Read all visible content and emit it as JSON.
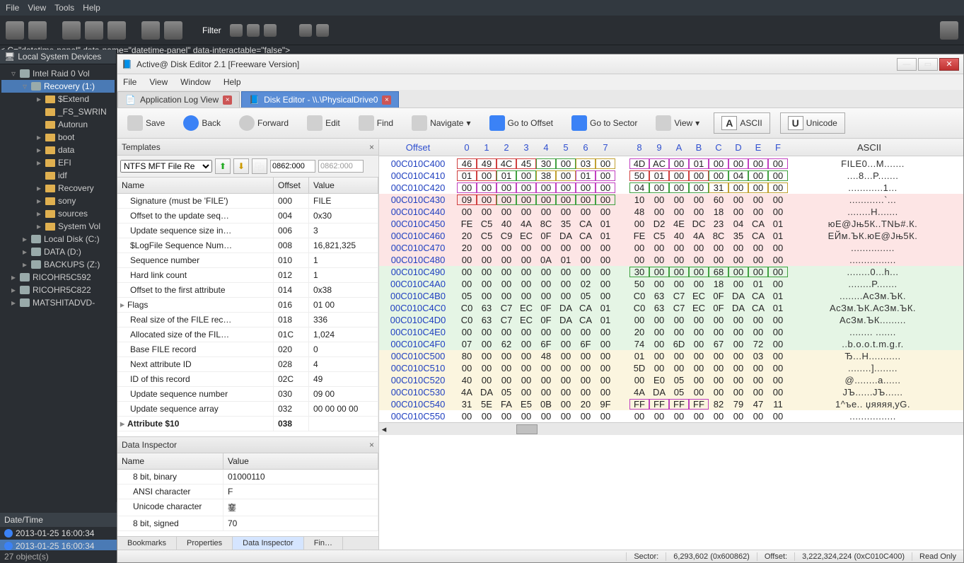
{
  "dark_app": {
    "menubar": [
      "File",
      "View",
      "Tools",
      "Help"
    ],
    "filter_label": "Filter",
    "devices_header": "Local System Devices",
    "tree": [
      {
        "lvl": 1,
        "exp": "▿",
        "icon": "drive",
        "label": "Intel   Raid 0 Vol"
      },
      {
        "lvl": 2,
        "exp": "▿",
        "icon": "drive",
        "label": "Recovery (1:)",
        "sel": true
      },
      {
        "lvl": 3,
        "exp": "▸",
        "icon": "folder",
        "label": "$Extend"
      },
      {
        "lvl": 3,
        "exp": "",
        "icon": "folder",
        "label": "_FS_SWRIN"
      },
      {
        "lvl": 3,
        "exp": "",
        "icon": "folder",
        "label": "Autorun"
      },
      {
        "lvl": 3,
        "exp": "▸",
        "icon": "folder",
        "label": "boot"
      },
      {
        "lvl": 3,
        "exp": "▸",
        "icon": "folder",
        "label": "data"
      },
      {
        "lvl": 3,
        "exp": "▸",
        "icon": "folder",
        "label": "EFI"
      },
      {
        "lvl": 3,
        "exp": "",
        "icon": "folder",
        "label": "idf"
      },
      {
        "lvl": 3,
        "exp": "▸",
        "icon": "folder",
        "label": "Recovery"
      },
      {
        "lvl": 3,
        "exp": "▸",
        "icon": "folder",
        "label": "sony"
      },
      {
        "lvl": 3,
        "exp": "▸",
        "icon": "folder",
        "label": "sources"
      },
      {
        "lvl": 3,
        "exp": "▸",
        "icon": "folder",
        "label": "System Vol"
      },
      {
        "lvl": 2,
        "exp": "▸",
        "icon": "drive",
        "label": "Local Disk (C:)"
      },
      {
        "lvl": 2,
        "exp": "▸",
        "icon": "drive",
        "label": "DATA (D:)"
      },
      {
        "lvl": 2,
        "exp": "▸",
        "icon": "drive",
        "label": "BACKUPS (Z:)"
      },
      {
        "lvl": 1,
        "exp": "▸",
        "icon": "drive",
        "label": "RICOHR5C592"
      },
      {
        "lvl": 1,
        "exp": "▸",
        "icon": "drive",
        "label": "RICOHR5C822"
      },
      {
        "lvl": 1,
        "exp": "▸",
        "icon": "drive",
        "label": "MATSHITADVD-"
      }
    ],
    "datetime_header": "Date/Time",
    "datetimes": [
      "2013-01-25 16:00:34",
      "2013-01-25 16:00:34"
    ],
    "status": "27 object(s)"
  },
  "editor": {
    "title": "Active@ Disk Editor 2.1 [Freeware Version]",
    "menubar": [
      "File",
      "View",
      "Window",
      "Help"
    ],
    "tabs": [
      {
        "label": "Application Log View",
        "active": false
      },
      {
        "label": "Disk Editor - \\\\.\\PhysicalDrive0",
        "active": true
      }
    ],
    "toolbar": {
      "save": "Save",
      "back": "Back",
      "forward": "Forward",
      "edit": "Edit",
      "find": "Find",
      "navigate": "Navigate",
      "goto_offset": "Go to Offset",
      "goto_sector": "Go to Sector",
      "view": "View",
      "ascii": "ASCII",
      "unicode": "Unicode"
    },
    "templates": {
      "title": "Templates",
      "dropdown": "NTFS MFT File Re",
      "offset_a": "0862:000",
      "offset_b": "0862:000",
      "cols": {
        "name": "Name",
        "offset": "Offset",
        "value": "Value"
      },
      "rows": [
        {
          "name": "Signature (must be 'FILE')",
          "offset": "000",
          "value": "FILE"
        },
        {
          "name": "Offset to the update seq…",
          "offset": "004",
          "value": "0x30"
        },
        {
          "name": "Update sequence size in…",
          "offset": "006",
          "value": "3"
        },
        {
          "name": "$LogFile Sequence Num…",
          "offset": "008",
          "value": "16,821,325"
        },
        {
          "name": "Sequence number",
          "offset": "010",
          "value": "1"
        },
        {
          "name": "Hard link count",
          "offset": "012",
          "value": "1"
        },
        {
          "name": "Offset to the first attribute",
          "offset": "014",
          "value": "0x38"
        },
        {
          "name": "Flags",
          "offset": "016",
          "value": "01 00",
          "expandable": true
        },
        {
          "name": "Real size of the FILE rec…",
          "offset": "018",
          "value": "336"
        },
        {
          "name": "Allocated size of the FIL…",
          "offset": "01C",
          "value": "1,024"
        },
        {
          "name": "Base FILE record",
          "offset": "020",
          "value": "0"
        },
        {
          "name": "Next attribute ID",
          "offset": "028",
          "value": "4"
        },
        {
          "name": "ID of this record",
          "offset": "02C",
          "value": "49"
        },
        {
          "name": "Update sequence number",
          "offset": "030",
          "value": "09 00"
        },
        {
          "name": "Update sequence array",
          "offset": "032",
          "value": "00 00 00 00"
        },
        {
          "name": "Attribute $10",
          "offset": "038",
          "value": "",
          "bold": true,
          "expandable": true
        }
      ]
    },
    "inspector": {
      "title": "Data Inspector",
      "cols": {
        "name": "Name",
        "value": "Value"
      },
      "rows": [
        {
          "name": "8 bit, binary",
          "value": "01000110"
        },
        {
          "name": "ANSI character",
          "value": "F"
        },
        {
          "name": "Unicode character",
          "value": "䥆"
        },
        {
          "name": "8 bit, signed",
          "value": "70"
        }
      ],
      "bottom_tabs": [
        "Bookmarks",
        "Properties",
        "Data Inspector",
        "Fin…"
      ]
    },
    "hex": {
      "header_offset": "Offset",
      "header_ascii": "ASCII",
      "nybbles": [
        "0",
        "1",
        "2",
        "3",
        "4",
        "5",
        "6",
        "7",
        "-",
        "8",
        "9",
        "A",
        "B",
        "C",
        "D",
        "E",
        "F"
      ],
      "rows": [
        {
          "off": "00C010C400",
          "l": [
            "46",
            "49",
            "4C",
            "45",
            "30",
            "00",
            "03",
            "00"
          ],
          "r": [
            "4D",
            "AC",
            "00",
            "01",
            "00",
            "00",
            "00",
            "00"
          ],
          "asc": "FILE0...M.......",
          "hl": {
            "l": [
              [
                "hl-red",
                0,
                3
              ],
              [
                "hl-grn",
                4,
                5
              ],
              [
                "hl-yel",
                6,
                7
              ]
            ],
            "r": [
              [
                "hl-mag",
                0,
                7
              ]
            ]
          }
        },
        {
          "off": "00C010C410",
          "l": [
            "01",
            "00",
            "01",
            "00",
            "38",
            "00",
            "01",
            "00"
          ],
          "r": [
            "50",
            "01",
            "00",
            "00",
            "00",
            "04",
            "00",
            "00"
          ],
          "asc": "....8...P.......",
          "hl": {
            "l": [
              [
                "hl-red",
                0,
                1
              ],
              [
                "hl-grn",
                2,
                3
              ],
              [
                "hl-yel",
                4,
                5
              ],
              [
                "hl-mag",
                6,
                7
              ]
            ],
            "r": [
              [
                "hl-red",
                0,
                3
              ],
              [
                "hl-grn",
                4,
                7
              ]
            ]
          }
        },
        {
          "off": "00C010C420",
          "l": [
            "00",
            "00",
            "00",
            "00",
            "00",
            "00",
            "00",
            "00"
          ],
          "r": [
            "04",
            "00",
            "00",
            "00",
            "31",
            "00",
            "00",
            "00"
          ],
          "asc": "............1...",
          "hl": {
            "l": [
              [
                "hl-mag",
                0,
                7
              ]
            ],
            "r": [
              [
                "hl-grn",
                0,
                3
              ],
              [
                "hl-yel",
                4,
                7
              ]
            ]
          }
        },
        {
          "off": "00C010C430",
          "l": [
            "09",
            "00",
            "00",
            "00",
            "00",
            "00",
            "00",
            "00"
          ],
          "r": [
            "10",
            "00",
            "00",
            "00",
            "60",
            "00",
            "00",
            "00"
          ],
          "asc": "............`...",
          "hl": {
            "l": [
              [
                "hl-red",
                0,
                1
              ],
              [
                "hl-grn",
                2,
                7
              ]
            ]
          },
          "bg": "bg-pink"
        },
        {
          "off": "00C010C440",
          "l": [
            "00",
            "00",
            "00",
            "00",
            "00",
            "00",
            "00",
            "00"
          ],
          "r": [
            "48",
            "00",
            "00",
            "00",
            "18",
            "00",
            "00",
            "00"
          ],
          "asc": "........H.......",
          "bg": "bg-pink"
        },
        {
          "off": "00C010C450",
          "l": [
            "FE",
            "C5",
            "40",
            "4A",
            "8C",
            "35",
            "CA",
            "01"
          ],
          "r": [
            "00",
            "D2",
            "4E",
            "DC",
            "23",
            "04",
            "CA",
            "01"
          ],
          "asc": "юЕ@Jњ5К..ТNЬ#.К.",
          "bg": "bg-pink"
        },
        {
          "off": "00C010C460",
          "l": [
            "20",
            "C5",
            "C9",
            "EC",
            "0F",
            "DA",
            "CA",
            "01"
          ],
          "r": [
            "FE",
            "C5",
            "40",
            "4A",
            "8C",
            "35",
            "CA",
            "01"
          ],
          "asc": " ЕЙм.ЪК.юЕ@Jњ5К.",
          "bg": "bg-pink"
        },
        {
          "off": "00C010C470",
          "l": [
            "20",
            "00",
            "00",
            "00",
            "00",
            "00",
            "00",
            "00"
          ],
          "r": [
            "00",
            "00",
            "00",
            "00",
            "00",
            "00",
            "00",
            "00"
          ],
          "asc": " ...............",
          "bg": "bg-pink"
        },
        {
          "off": "00C010C480",
          "l": [
            "00",
            "00",
            "00",
            "00",
            "0A",
            "01",
            "00",
            "00"
          ],
          "r": [
            "00",
            "00",
            "00",
            "00",
            "00",
            "00",
            "00",
            "00"
          ],
          "asc": "................",
          "bg": "bg-pink"
        },
        {
          "off": "00C010C490",
          "l": [
            "00",
            "00",
            "00",
            "00",
            "00",
            "00",
            "00",
            "00"
          ],
          "r": [
            "30",
            "00",
            "00",
            "00",
            "68",
            "00",
            "00",
            "00"
          ],
          "asc": "........0...h...",
          "hl": {
            "r": [
              [
                "hl-grn",
                0,
                7
              ]
            ]
          },
          "bg": "bg-grn"
        },
        {
          "off": "00C010C4A0",
          "l": [
            "00",
            "00",
            "00",
            "00",
            "00",
            "00",
            "02",
            "00"
          ],
          "r": [
            "50",
            "00",
            "00",
            "00",
            "18",
            "00",
            "01",
            "00"
          ],
          "asc": "........P.......",
          "bg": "bg-grn"
        },
        {
          "off": "00C010C4B0",
          "l": [
            "05",
            "00",
            "00",
            "00",
            "00",
            "00",
            "05",
            "00"
          ],
          "r": [
            "C0",
            "63",
            "C7",
            "EC",
            "0F",
            "DA",
            "CA",
            "01"
          ],
          "asc": "........АcЗм.ЪК.",
          "bg": "bg-grn"
        },
        {
          "off": "00C010C4C0",
          "l": [
            "C0",
            "63",
            "C7",
            "EC",
            "0F",
            "DA",
            "CA",
            "01"
          ],
          "r": [
            "C0",
            "63",
            "C7",
            "EC",
            "0F",
            "DA",
            "CA",
            "01"
          ],
          "asc": "АcЗм.ЪК.АcЗм.ЪК.",
          "bg": "bg-grn"
        },
        {
          "off": "00C010C4D0",
          "l": [
            "C0",
            "63",
            "C7",
            "EC",
            "0F",
            "DA",
            "CA",
            "01"
          ],
          "r": [
            "00",
            "00",
            "00",
            "00",
            "00",
            "00",
            "00",
            "00"
          ],
          "asc": "АcЗм.ЪК.........",
          "bg": "bg-grn"
        },
        {
          "off": "00C010C4E0",
          "l": [
            "00",
            "00",
            "00",
            "00",
            "00",
            "00",
            "00",
            "00"
          ],
          "r": [
            "20",
            "00",
            "00",
            "00",
            "00",
            "00",
            "00",
            "00"
          ],
          "asc": "........ .......",
          "bg": "bg-grn"
        },
        {
          "off": "00C010C4F0",
          "l": [
            "07",
            "00",
            "62",
            "00",
            "6F",
            "00",
            "6F",
            "00"
          ],
          "r": [
            "74",
            "00",
            "6D",
            "00",
            "67",
            "00",
            "72",
            "00"
          ],
          "asc": "..b.o.o.t.m.g.r.",
          "bg": "bg-grn"
        },
        {
          "off": "00C010C500",
          "l": [
            "80",
            "00",
            "00",
            "00",
            "48",
            "00",
            "00",
            "00"
          ],
          "r": [
            "01",
            "00",
            "00",
            "00",
            "00",
            "00",
            "03",
            "00"
          ],
          "asc": "Ђ...H...........",
          "bg": "bg-yel"
        },
        {
          "off": "00C010C510",
          "l": [
            "00",
            "00",
            "00",
            "00",
            "00",
            "00",
            "00",
            "00"
          ],
          "r": [
            "5D",
            "00",
            "00",
            "00",
            "00",
            "00",
            "00",
            "00"
          ],
          "asc": "........]........",
          "bg": "bg-yel"
        },
        {
          "off": "00C010C520",
          "l": [
            "40",
            "00",
            "00",
            "00",
            "00",
            "00",
            "00",
            "00"
          ],
          "r": [
            "00",
            "E0",
            "05",
            "00",
            "00",
            "00",
            "00",
            "00"
          ],
          "asc": "@........а......",
          "bg": "bg-yel"
        },
        {
          "off": "00C010C530",
          "l": [
            "4A",
            "DA",
            "05",
            "00",
            "00",
            "00",
            "00",
            "00"
          ],
          "r": [
            "4A",
            "DA",
            "05",
            "00",
            "00",
            "00",
            "00",
            "00"
          ],
          "asc": "JЪ......JЪ......",
          "bg": "bg-yel"
        },
        {
          "off": "00C010C540",
          "l": [
            "31",
            "5E",
            "FA",
            "E5",
            "0B",
            "00",
            "20",
            "9F"
          ],
          "r": [
            "FF",
            "FF",
            "FF",
            "FF",
            "82",
            "79",
            "47",
            "11"
          ],
          "asc": "1^ъе.. џяяяя‚yG.",
          "hl": {
            "r": [
              [
                "hl-mag",
                0,
                3
              ]
            ]
          },
          "bg": "bg-yel"
        },
        {
          "off": "00C010C550",
          "l": [
            "00",
            "00",
            "00",
            "00",
            "00",
            "00",
            "00",
            "00"
          ],
          "r": [
            "00",
            "00",
            "00",
            "00",
            "00",
            "00",
            "00",
            "00"
          ],
          "asc": "................"
        }
      ]
    },
    "status": {
      "sector_label": "Sector:",
      "sector_value": "6,293,602 (0x600862)",
      "offset_label": "Offset:",
      "offset_value": "3,222,324,224 (0xC010C400)",
      "readonly": "Read Only"
    }
  }
}
